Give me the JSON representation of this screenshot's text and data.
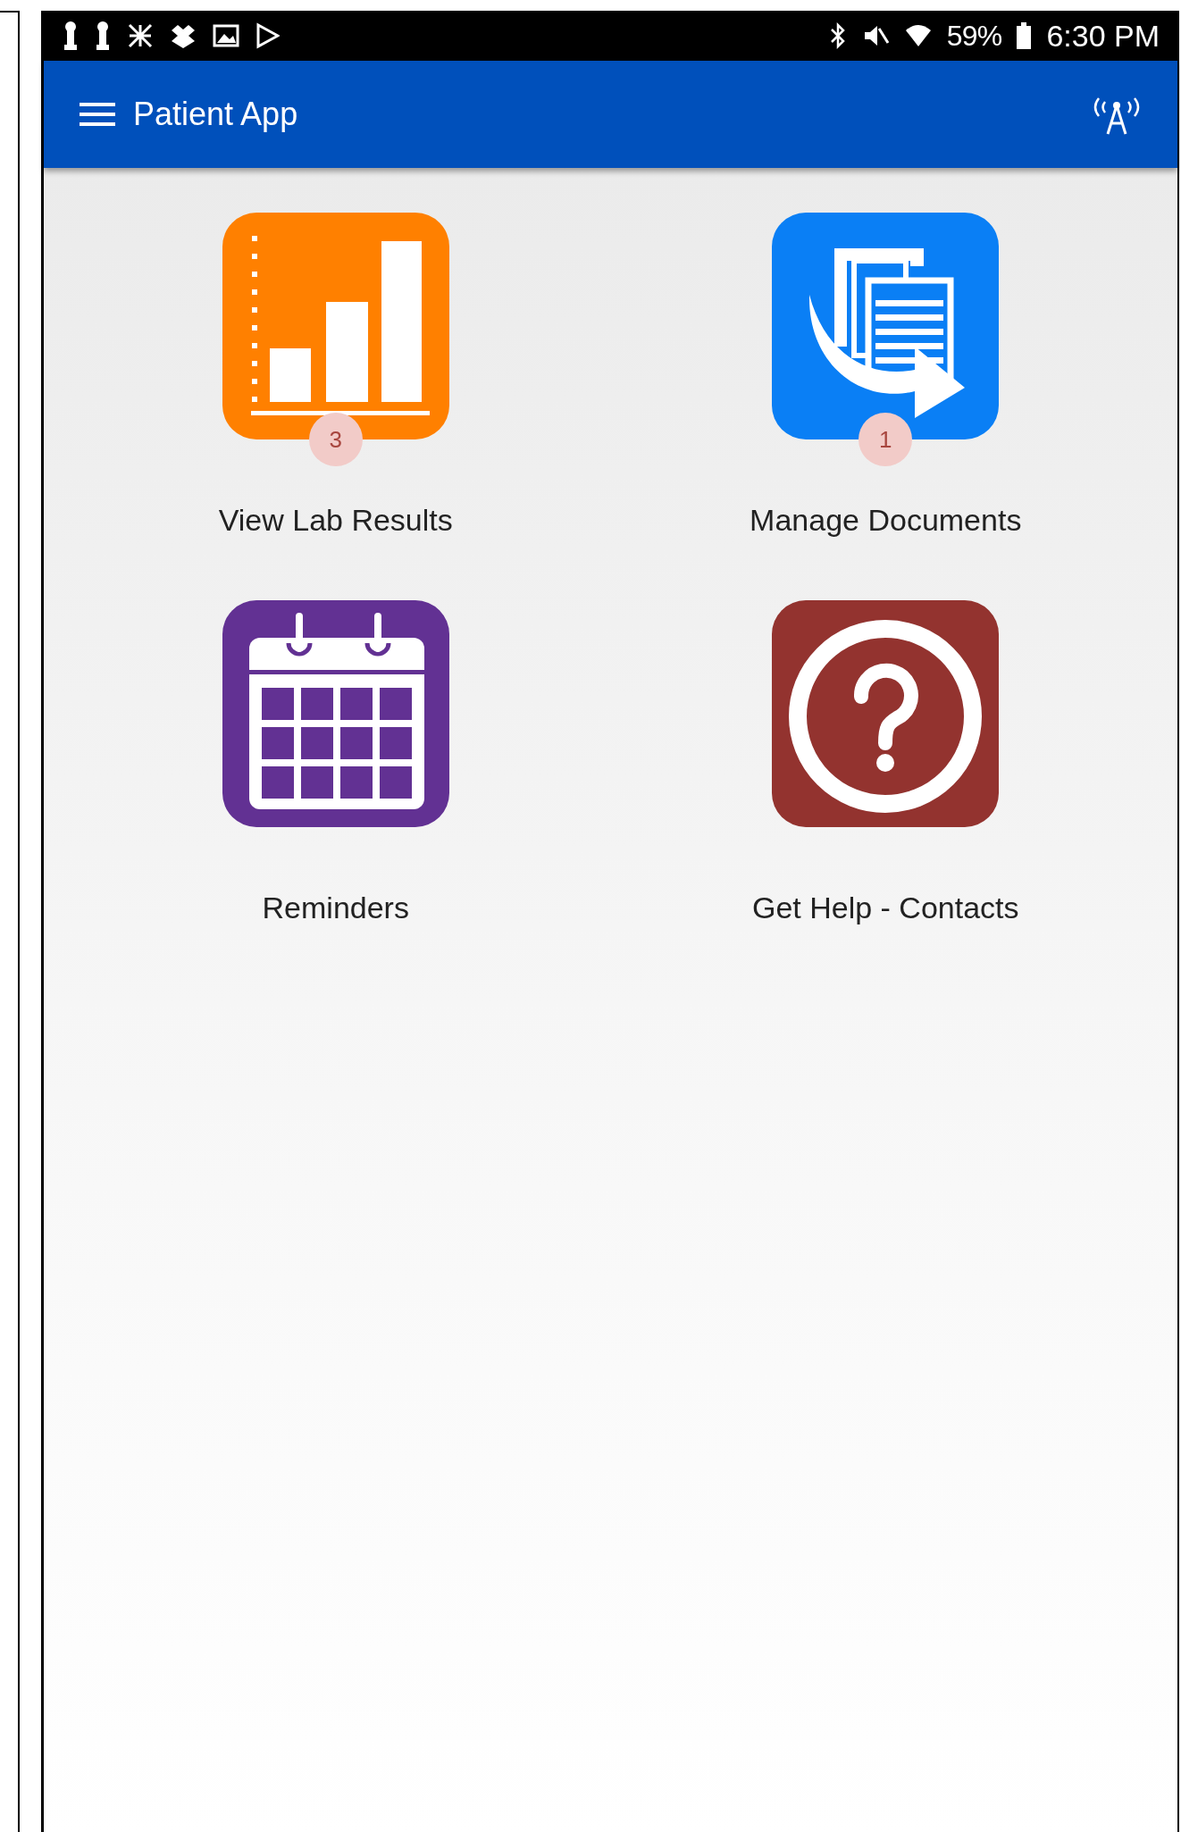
{
  "status_bar": {
    "battery": "59%",
    "time": "6:30 PM"
  },
  "app_bar": {
    "title": "Patient App"
  },
  "tiles": [
    {
      "kind": "lab-results",
      "label": "View Lab Results",
      "badge": "3"
    },
    {
      "kind": "documents",
      "label": "Manage Documents",
      "badge": "1"
    },
    {
      "kind": "reminders",
      "label": "Reminders"
    },
    {
      "kind": "help",
      "label": "Get Help - Contacts"
    }
  ]
}
